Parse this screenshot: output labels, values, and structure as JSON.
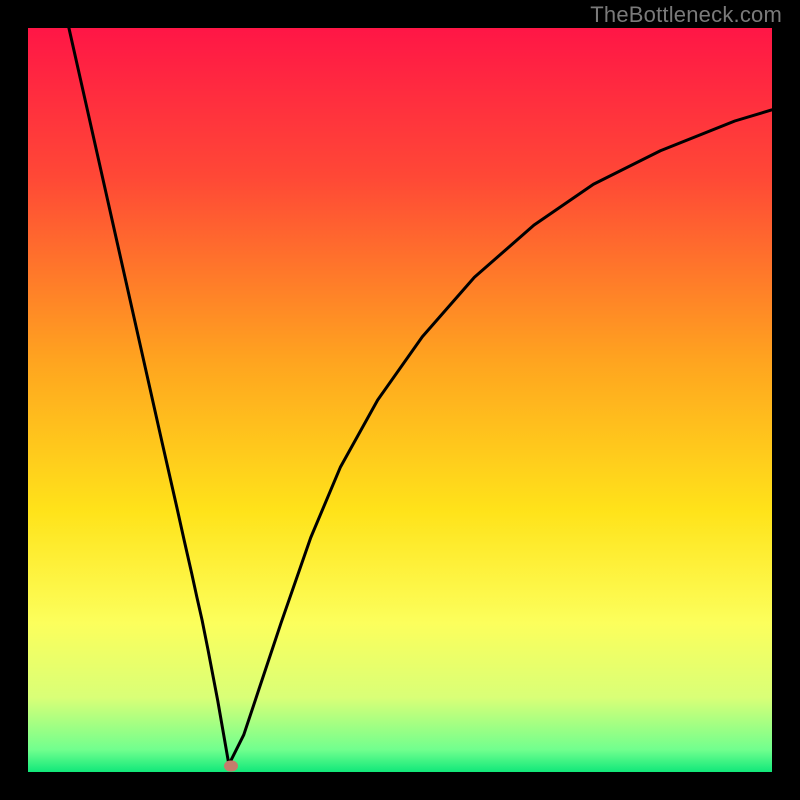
{
  "attribution": "TheBottleneck.com",
  "chart_data": {
    "type": "line",
    "title": "",
    "xlabel": "",
    "ylabel": "",
    "xlim": [
      0,
      100
    ],
    "ylim": [
      0,
      100
    ],
    "grid": false,
    "legend": false,
    "gradient_stops": [
      {
        "offset": 0.0,
        "color": "#ff1646"
      },
      {
        "offset": 0.2,
        "color": "#ff4836"
      },
      {
        "offset": 0.45,
        "color": "#ffa51f"
      },
      {
        "offset": 0.65,
        "color": "#ffe31a"
      },
      {
        "offset": 0.8,
        "color": "#fcff5c"
      },
      {
        "offset": 0.9,
        "color": "#d9ff77"
      },
      {
        "offset": 0.97,
        "color": "#71ff8e"
      },
      {
        "offset": 1.0,
        "color": "#11e87a"
      }
    ],
    "series": [
      {
        "name": "bottleneck-curve",
        "stroke": "#000000",
        "stroke_width": 3,
        "x": [
          5.5,
          8,
          10,
          12,
          14,
          16,
          18,
          20,
          21,
          22,
          22.7,
          23.4,
          24.2,
          25.5,
          27,
          29,
          31,
          34,
          38,
          42,
          47,
          53,
          60,
          68,
          76,
          85,
          95,
          100
        ],
        "y": [
          100,
          88.9,
          80,
          71.1,
          62.2,
          53.3,
          44.4,
          35.6,
          31.1,
          26.7,
          23.5,
          20.4,
          16.4,
          9.6,
          1.0,
          5.0,
          11.0,
          20.0,
          31.5,
          41.0,
          50.0,
          58.5,
          66.5,
          73.5,
          79.0,
          83.5,
          87.5,
          89.0
        ]
      }
    ],
    "marker": {
      "x": 27.3,
      "y": 0.8,
      "color": "#c47c6c"
    }
  }
}
